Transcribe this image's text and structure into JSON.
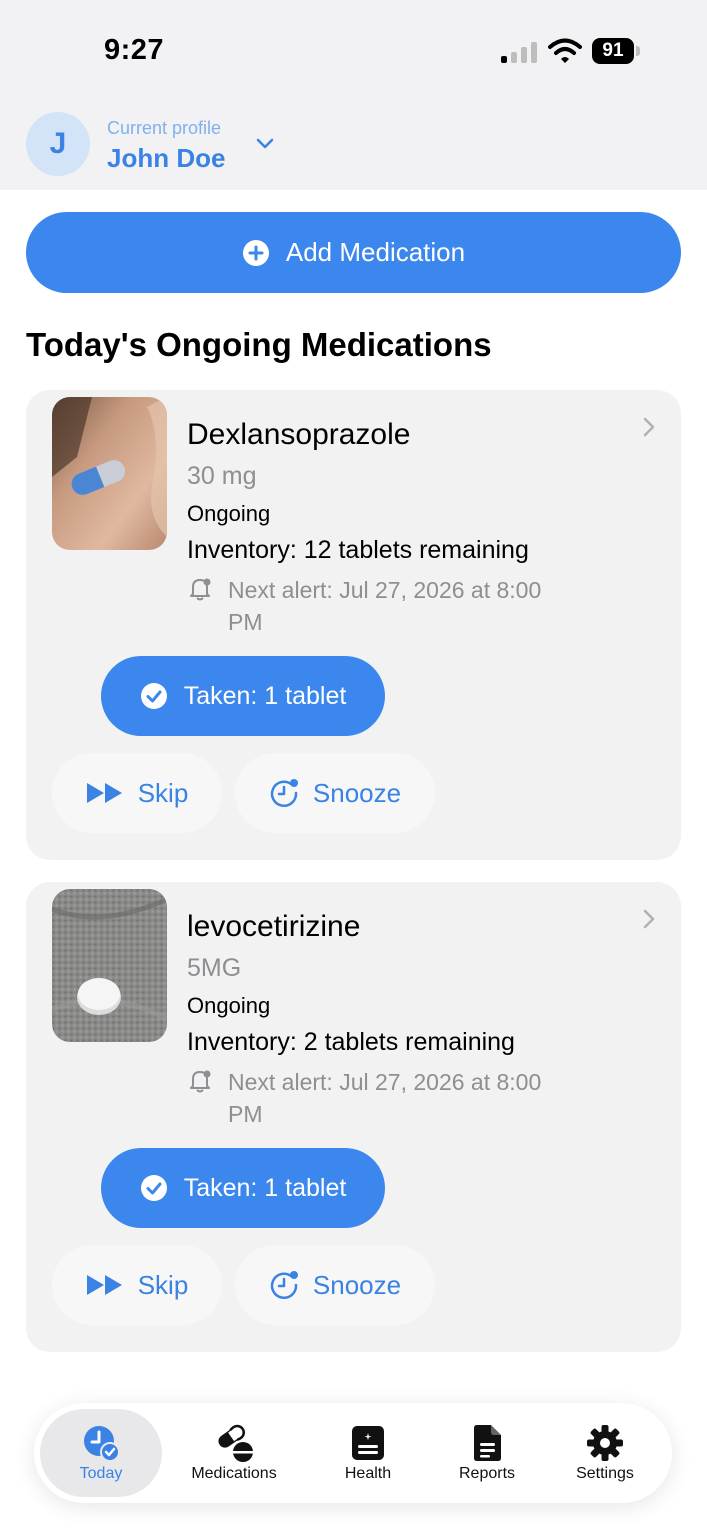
{
  "status_bar": {
    "time": "9:27",
    "battery": "91"
  },
  "profile": {
    "initial": "J",
    "caption": "Current profile",
    "name": "John Doe"
  },
  "add_medication": {
    "label": "Add Medication"
  },
  "section_title": "Today's Ongoing Medications",
  "medications": [
    {
      "name": "Dexlansoprazole",
      "dose": "30 mg",
      "status": "Ongoing",
      "inventory": "Inventory: 12 tablets remaining",
      "next_alert": "Next alert: Jul 27, 2026 at 8:00 PM",
      "taken_label": "Taken: 1 tablet",
      "skip_label": "Skip",
      "snooze_label": "Snooze"
    },
    {
      "name": "levocetirizine",
      "dose": "5MG",
      "status": "Ongoing",
      "inventory": "Inventory: 2 tablets remaining",
      "next_alert": "Next alert: Jul 27, 2026 at 8:00 PM",
      "taken_label": "Taken: 1 tablet",
      "skip_label": "Skip",
      "snooze_label": "Snooze"
    }
  ],
  "tab_bar": {
    "active": "Today",
    "tabs": [
      {
        "label": "Today",
        "icon": "clock-check-icon"
      },
      {
        "label": "Medications",
        "icon": "pills-icon"
      },
      {
        "label": "Health",
        "icon": "health-record-icon"
      },
      {
        "label": "Reports",
        "icon": "document-icon"
      },
      {
        "label": "Settings",
        "icon": "gear-icon"
      }
    ]
  },
  "colors": {
    "accent": "#3b87ee",
    "card_background": "#f2f2f2",
    "header_background": "#f2f2f4",
    "secondary_text": "#8e8e93"
  }
}
